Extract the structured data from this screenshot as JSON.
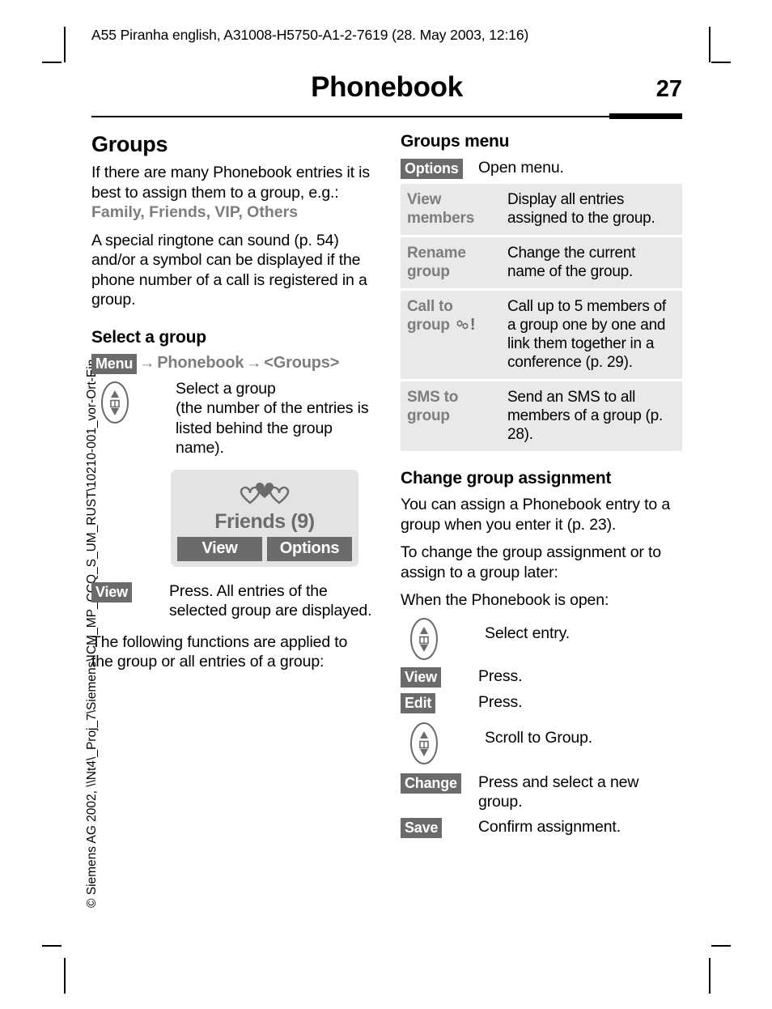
{
  "header": {
    "running_head": "A55 Piranha english, A31008-H5750-A1-2-7619 (28. May 2003, 12:16)",
    "page_title": "Phonebook",
    "page_number": "27"
  },
  "side_note": "© Siemens AG 2002, \\\\Nt4\\_Proj_7\\Siemens\\ICM_MP_CCQ_S_UM_RUST\\10210-001_vor-Ort-Ein-",
  "left_column": {
    "section_title": "Groups",
    "intro_part1": "If there are many Phonebook entries it is best to assign them to a group, e.g.: ",
    "intro_groups": "Family, Friends, VIP, Others",
    "intro_part2": "A special ringtone can sound (p. 54) and/or a symbol can be displayed if the phone number of a call is registered in a group.",
    "select_group_title": "Select a group",
    "nav_path": {
      "menu_chip": "Menu",
      "arrow": "→",
      "step1": "Phonebook",
      "step2": "<Groups>"
    },
    "nav_step_text": "Select a group\n(the number of the entries is listed behind the group name).",
    "phone_mock": {
      "label": "Friends (9)",
      "softkey_left": "View",
      "softkey_right": "Options"
    },
    "view_step": {
      "chip": "View",
      "text": "Press. All entries of the selected group are displayed."
    },
    "closing_text": "The following functions are applied to the group or all entries of a group:"
  },
  "right_column": {
    "menu_title": "Groups menu",
    "options_chip": "Options",
    "options_chip_text": "Open menu.",
    "options_table": [
      {
        "name": "View members",
        "desc": "Display all entries assigned to the group.",
        "icon": ""
      },
      {
        "name": "Rename group",
        "desc": "Change the current name of the group.",
        "icon": ""
      },
      {
        "name": "Call to group",
        "desc": "Call up to 5 members of a group one by one and link them together in a conference (p. 29).",
        "icon": "conference-call-icon"
      },
      {
        "name": "SMS to group",
        "desc": "Send an SMS to all members of a group (p. 28).",
        "icon": ""
      }
    ],
    "change_title": "Change group assignment",
    "change_p1": "You can assign a Phonebook entry to a group when you enter it (p. 23).",
    "change_p2": "To change the group assignment or to assign to a group later:",
    "change_p3": "When the Phonebook is open:",
    "steps": [
      {
        "key_type": "navkey",
        "key_label": "",
        "text": "Select entry."
      },
      {
        "key_type": "chip",
        "key_label": "View",
        "text": "Press."
      },
      {
        "key_type": "chip",
        "key_label": "Edit",
        "text": "Press."
      },
      {
        "key_type": "navkey",
        "key_label": "",
        "text": "Scroll to Group."
      },
      {
        "key_type": "chip",
        "key_label": "Change",
        "text": "Press and select a new group."
      },
      {
        "key_type": "chip",
        "key_label": "Save",
        "text": "Confirm assignment."
      }
    ]
  },
  "colors": {
    "chip_bg": "#6b6b6b",
    "grey_text": "#7d7d7d",
    "table_row_bg": "#e9e9e9",
    "mock_bg": "#e3e3e3"
  }
}
